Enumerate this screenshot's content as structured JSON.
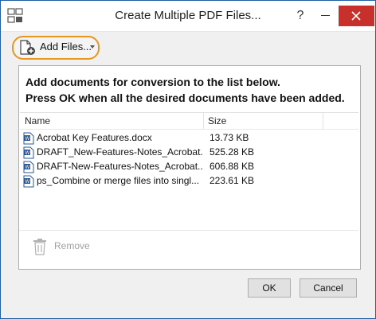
{
  "window": {
    "title": "Create Multiple PDF Files...",
    "help_label": "?"
  },
  "toolbar": {
    "add_files_label": "Add Files..."
  },
  "instructions": {
    "line1": "Add documents for conversion to the list below.",
    "line2": "Press OK when all the desired documents have been added."
  },
  "file_list": {
    "columns": [
      "Name",
      "Size"
    ],
    "rows": [
      {
        "name": "Acrobat Key Features.docx",
        "size": "13.73 KB"
      },
      {
        "name": "DRAFT_New-Features-Notes_Acrobat...",
        "size": "525.28 KB"
      },
      {
        "name": "DRAFT-New-Features-Notes_Acrobat...",
        "size": "606.88 KB"
      },
      {
        "name": "ps_Combine or merge files into singl...",
        "size": "223.61 KB"
      }
    ]
  },
  "actions": {
    "remove_label": "Remove",
    "ok_label": "OK",
    "cancel_label": "Cancel"
  },
  "colors": {
    "highlight_ring": "#e8961f",
    "close_button": "#c7302b",
    "word_icon": "#2b5797"
  }
}
